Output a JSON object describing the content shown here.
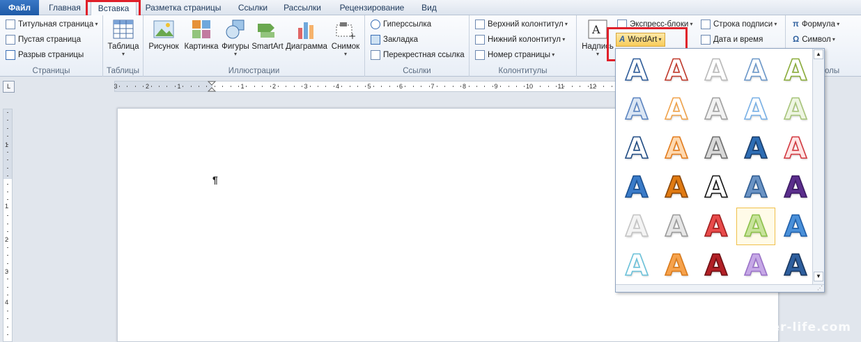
{
  "tabs": {
    "file": "Файл",
    "home": "Главная",
    "insert": "Вставка",
    "layout": "Разметка страницы",
    "refs": "Ссылки",
    "mail": "Рассылки",
    "review": "Рецензирование",
    "view": "Вид"
  },
  "groups": {
    "pages": {
      "label": "Страницы",
      "cover": "Титульная страница",
      "blank": "Пустая страница",
      "break": "Разрыв страницы"
    },
    "tables": {
      "label": "Таблицы",
      "table": "Таблица"
    },
    "illustrations": {
      "label": "Иллюстрации",
      "picture": "Рисунок",
      "clipart": "Картинка",
      "shapes": "Фигуры",
      "smartart": "SmartArt",
      "chart": "Диаграмма",
      "screenshot": "Снимок"
    },
    "links": {
      "label": "Ссылки",
      "hyperlink": "Гиперссылка",
      "bookmark": "Закладка",
      "crossref": "Перекрестная ссылка"
    },
    "headers": {
      "label": "Колонтитулы",
      "header": "Верхний колонтитул",
      "footer": "Нижний колонтитул",
      "pagenum": "Номер страницы"
    },
    "text": {
      "textbox": "Надпись",
      "quickparts": "Экспресс-блоки",
      "wordart": "WordArt",
      "sigline": "Строка подписи",
      "datetime": "Дата и время"
    },
    "symbols": {
      "label": "олы",
      "equation": "Формула",
      "symbol": "Символ"
    }
  },
  "ruler": {
    "ticks": [
      "3",
      "2",
      "1",
      "1",
      "2",
      "3",
      "4",
      "5",
      "6",
      "7",
      "8",
      "9",
      "10",
      "11",
      "12"
    ],
    "vticks": [
      "1",
      "1",
      "2",
      "3",
      "4"
    ]
  },
  "doc": {
    "pilcrow": "¶"
  },
  "watermark": "user-life.com",
  "colors": {
    "accent_red": "#e0202a",
    "ribbon_blue": "#1e5aa7"
  },
  "gallery_styles": [
    {
      "icon": "wordart-outline-blue",
      "fill": "#ffffff",
      "stroke": "#2f5d9a"
    },
    {
      "icon": "wordart-outline-red",
      "fill": "#ffffff",
      "stroke": "#c0392b"
    },
    {
      "icon": "wordart-outline-gray",
      "fill": "#ffffff",
      "stroke": "#b9b9b9"
    },
    {
      "icon": "wordart-outline-lightblue",
      "fill": "#ffffff",
      "stroke": "#6b97c9"
    },
    {
      "icon": "wordart-outline-green",
      "fill": "#ffffff",
      "stroke": "#8aac3a"
    },
    {
      "icon": "wordart-blue-gradient",
      "fill": "#dbe6f4",
      "stroke": "#5b84c0"
    },
    {
      "icon": "wordart-orange-outline",
      "fill": "#ffffff",
      "stroke": "#f0a24a"
    },
    {
      "icon": "wordart-gray-gradient",
      "fill": "#f2f2f2",
      "stroke": "#a0a0a0"
    },
    {
      "icon": "wordart-sky-outline",
      "fill": "#ffffff",
      "stroke": "#78b0e6"
    },
    {
      "icon": "wordart-pale-green",
      "fill": "#eef5e2",
      "stroke": "#a7c47a"
    },
    {
      "icon": "wordart-dark-blue-outline",
      "fill": "#ffffff",
      "stroke": "#1e4a82"
    },
    {
      "icon": "wordart-orange-bold",
      "fill": "#ffd9b0",
      "stroke": "#e27b1c"
    },
    {
      "icon": "wordart-silver",
      "fill": "#d8d8d8",
      "stroke": "#6d6d6d"
    },
    {
      "icon": "wordart-blue-solid",
      "fill": "#2e6db4",
      "stroke": "#1a3d6a"
    },
    {
      "icon": "wordart-red-outline",
      "fill": "#ffe5e5",
      "stroke": "#d2383f"
    },
    {
      "icon": "wordart-blue-fill",
      "fill": "#3a7bc8",
      "stroke": "#1a4f8f"
    },
    {
      "icon": "wordart-orange-fill",
      "fill": "#e07a12",
      "stroke": "#8a4708"
    },
    {
      "icon": "wordart-black-outline",
      "fill": "#ffffff",
      "stroke": "#111111"
    },
    {
      "icon": "wordart-steel-blue",
      "fill": "#6a93c4",
      "stroke": "#2e5b90"
    },
    {
      "icon": "wordart-purple",
      "fill": "#5b2e8c",
      "stroke": "#3b1a63"
    },
    {
      "icon": "wordart-light-gray",
      "fill": "#f4f4f4",
      "stroke": "#c4c4c4"
    },
    {
      "icon": "wordart-gray-3d",
      "fill": "#e6e6e6",
      "stroke": "#9a9a9a"
    },
    {
      "icon": "wordart-red-3d",
      "fill": "#e84b4b",
      "stroke": "#a01e1e"
    },
    {
      "icon": "wordart-green-glow",
      "fill": "#c7e39a",
      "stroke": "#8cc04a"
    },
    {
      "icon": "wordart-blue-reflect",
      "fill": "#4a90d9",
      "stroke": "#1f5ea8"
    },
    {
      "icon": "wordart-cyan-outline",
      "fill": "#ffffff",
      "stroke": "#6ac1d9"
    },
    {
      "icon": "wordart-orange-gradient",
      "fill": "#f6a24c",
      "stroke": "#d87a1c"
    },
    {
      "icon": "wordart-dark-red",
      "fill": "#b22026",
      "stroke": "#6e0f13"
    },
    {
      "icon": "wordart-lavender",
      "fill": "#c6a8e6",
      "stroke": "#9a72c8"
    },
    {
      "icon": "wordart-blue-deep",
      "fill": "#2e5f9e",
      "stroke": "#18365e"
    }
  ]
}
